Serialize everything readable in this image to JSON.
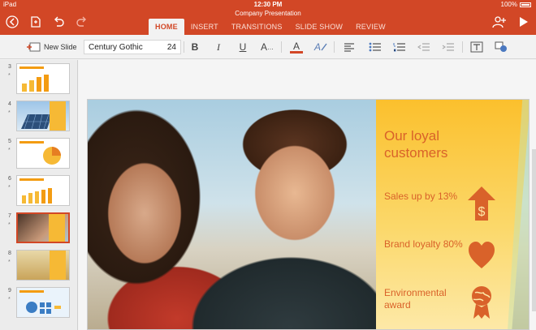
{
  "status": {
    "carrier": "iPad",
    "time": "12:30 PM",
    "battery": "100%"
  },
  "document": {
    "title": "Company Presentation"
  },
  "ribbon": {
    "tabs": [
      {
        "label": "HOME",
        "active": true
      },
      {
        "label": "INSERT",
        "active": false
      },
      {
        "label": "TRANSITIONS",
        "active": false
      },
      {
        "label": "SLIDE SHOW",
        "active": false
      },
      {
        "label": "REVIEW",
        "active": false
      }
    ]
  },
  "toolbar": {
    "new_slide_label": "New Slide",
    "font_name": "Century Gothic",
    "font_size": "24",
    "bold": "B",
    "italic": "I",
    "underline": "U",
    "font_effects": "A",
    "font_color": "A",
    "highlight": "A"
  },
  "thumbnails": [
    {
      "number": "3",
      "starred": "*"
    },
    {
      "number": "4",
      "starred": "*"
    },
    {
      "number": "5",
      "starred": "*"
    },
    {
      "number": "6",
      "starred": "*"
    },
    {
      "number": "7",
      "starred": "*"
    },
    {
      "number": "8",
      "starred": "*"
    },
    {
      "number": "9",
      "starred": "*"
    }
  ],
  "slide": {
    "title": "Our loyal customers",
    "items": [
      {
        "text": "Sales up by 13%",
        "icon": "dollar-arrow-icon"
      },
      {
        "text": "Brand loyalty 80%",
        "icon": "heart-icon"
      },
      {
        "text": "Environmental award",
        "icon": "globe-award-icon"
      }
    ]
  },
  "colors": {
    "accent": "#d24726",
    "slide_text": "#d9622a",
    "band": "#fbc02d"
  }
}
